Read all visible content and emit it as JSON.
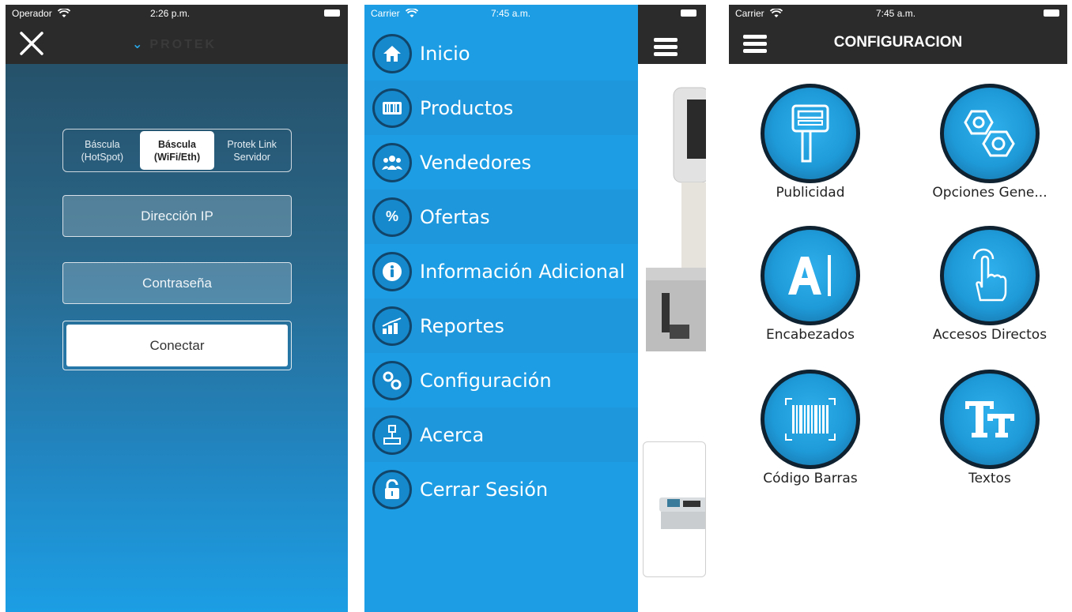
{
  "phone1": {
    "status": {
      "carrier": "Operador",
      "time": "2:26 p.m."
    },
    "logo_text": "PROTEK",
    "segments": [
      {
        "line1": "Báscula",
        "line2": "(HotSpot)",
        "active": false
      },
      {
        "line1": "Báscula",
        "line2": "(WiFi/Eth)",
        "active": true
      },
      {
        "line1": "Protek Link",
        "line2": "Servidor",
        "active": false
      }
    ],
    "ip_placeholder": "Dirección IP",
    "password_placeholder": "Contraseña",
    "connect_label": "Conectar"
  },
  "phone2": {
    "status": {
      "carrier": "Carrier",
      "time": "7:45 a.m."
    },
    "menu": [
      {
        "label": "Inicio",
        "icon": "home-icon"
      },
      {
        "label": "Productos",
        "icon": "barcode-icon"
      },
      {
        "label": "Vendedores",
        "icon": "users-icon"
      },
      {
        "label": "Ofertas",
        "icon": "percent-icon"
      },
      {
        "label": "Información Adicional",
        "icon": "info-icon"
      },
      {
        "label": "Reportes",
        "icon": "chart-icon"
      },
      {
        "label": "Configuración",
        "icon": "gears-icon"
      },
      {
        "label": "Acerca",
        "icon": "scale-icon"
      },
      {
        "label": "Cerrar Sesión",
        "icon": "unlock-icon"
      }
    ]
  },
  "phone3": {
    "status": {
      "carrier": "Carrier",
      "time": "7:45 a.m."
    },
    "title": "CONFIGURACION",
    "tiles": [
      {
        "label": "Publicidad",
        "icon": "scale-display-icon"
      },
      {
        "label": "Opciones Gene...",
        "icon": "hex-nuts-icon"
      },
      {
        "label": "Encabezados",
        "icon": "text-cursor-icon"
      },
      {
        "label": "Accesos Directos",
        "icon": "touch-icon"
      },
      {
        "label": "Código Barras",
        "icon": "barcode-scan-icon"
      },
      {
        "label": "Textos",
        "icon": "font-size-icon"
      }
    ]
  },
  "colors": {
    "menu_blue": "#1d9ee4",
    "topbar_dark": "#2b2b2b",
    "icon_ring": "#0e2231"
  }
}
